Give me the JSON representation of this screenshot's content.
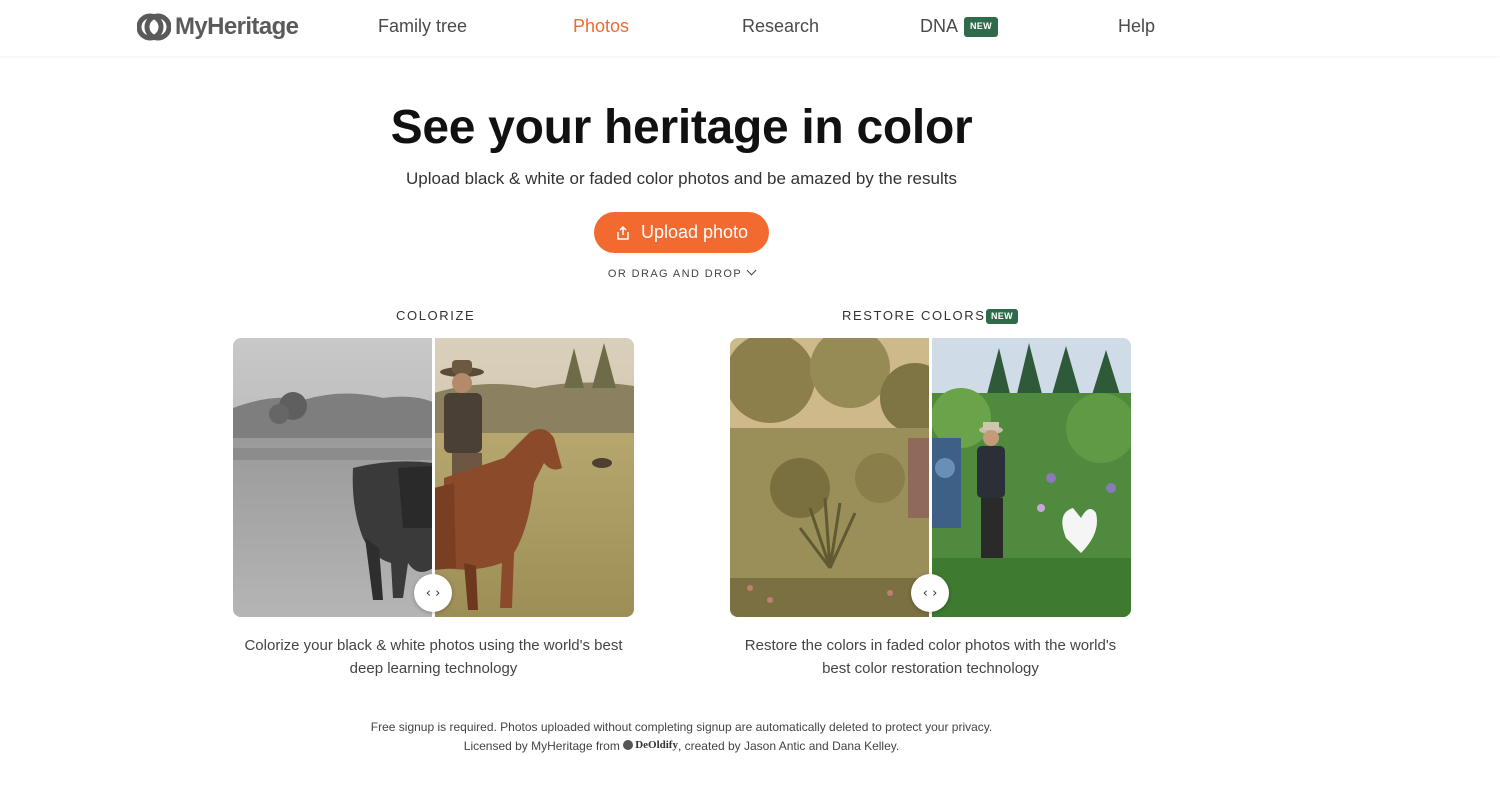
{
  "header": {
    "logo_text": "MyHeritage",
    "nav": [
      {
        "label": "Family tree"
      },
      {
        "label": "Photos"
      },
      {
        "label": "Research"
      },
      {
        "label": "DNA"
      },
      {
        "label": "Help"
      }
    ],
    "dna_badge": "NEW",
    "active_color": "#f26a30"
  },
  "hero": {
    "title": "See your heritage in color",
    "subtitle": "Upload black & white or faded color photos and be amazed by the results",
    "upload_label": "Upload photo",
    "drag_drop": "OR DRAG AND DROP"
  },
  "sections": {
    "colorize": {
      "label": "COLORIZE",
      "description_line1": "Colorize your black & white photos using the world's best",
      "description_line2": "deep learning technology"
    },
    "restore": {
      "label": "RESTORE COLORS",
      "badge": "NEW",
      "description_line1": "Restore the colors in faded color photos with the world's",
      "description_line2": "best color restoration technology"
    }
  },
  "handle_glyph": "‹ ›",
  "footer": {
    "line1": "Free signup is required. Photos uploaded without completing signup are automatically deleted to protect your privacy.",
    "line2_prefix": "Licensed by MyHeritage from",
    "deoldify": "DeOldify",
    "line2_suffix": ", created by Jason Antic and Dana Kelley."
  },
  "colors": {
    "accent": "#f26a30",
    "badge_green": "#2f6a4b"
  }
}
